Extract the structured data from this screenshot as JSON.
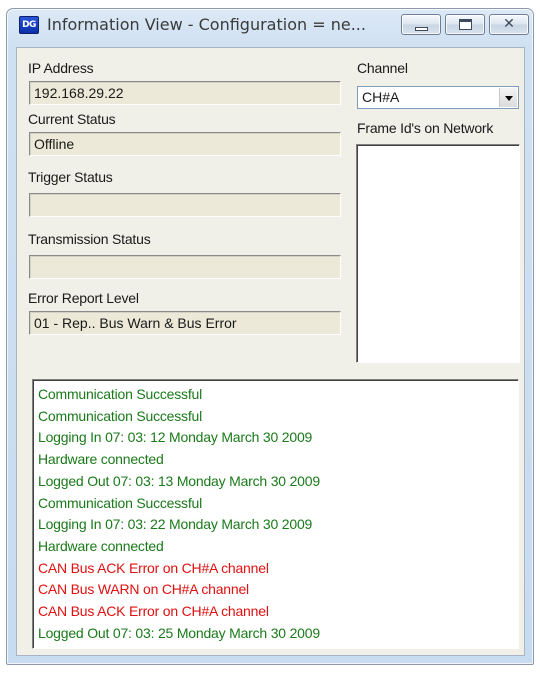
{
  "window": {
    "icon_text": "DG",
    "title": "Information View  - Configuration = ne..."
  },
  "fields": {
    "ip_address": {
      "label": "IP Address",
      "value": "192.168.29.22"
    },
    "current_status": {
      "label": "Current Status",
      "value": "Offline"
    },
    "trigger_status": {
      "label": "Trigger Status",
      "value": ""
    },
    "transmission_status": {
      "label": "Transmission Status",
      "value": ""
    },
    "error_report_level": {
      "label": "Error Report Level",
      "value": "01 - Rep.. Bus Warn & Bus Error"
    }
  },
  "channel": {
    "label": "Channel",
    "selected": "CH#A"
  },
  "frame_ids": {
    "label": "Frame Id's on Network",
    "items": []
  },
  "colors": {
    "success": "#1a7a1a",
    "error": "#e01010"
  },
  "log": [
    {
      "text": "Communication Successful",
      "level": "success"
    },
    {
      "text": "Communication Successful",
      "level": "success"
    },
    {
      "text": "Logging In 07: 03: 12  Monday March 30 2009",
      "level": "success"
    },
    {
      "text": "Hardware connected",
      "level": "success"
    },
    {
      "text": "Logged Out 07: 03: 13  Monday March 30 2009",
      "level": "success"
    },
    {
      "text": "Communication Successful",
      "level": "success"
    },
    {
      "text": "Logging In 07: 03: 22  Monday March 30 2009",
      "level": "success"
    },
    {
      "text": "Hardware connected",
      "level": "success"
    },
    {
      "text": "CAN Bus ACK Error on CH#A channel",
      "level": "error"
    },
    {
      "text": "CAN Bus WARN on CH#A channel",
      "level": "error"
    },
    {
      "text": "CAN Bus ACK Error on CH#A channel",
      "level": "error"
    },
    {
      "text": "Logged Out 07: 03: 25  Monday March 30 2009",
      "level": "success"
    }
  ]
}
